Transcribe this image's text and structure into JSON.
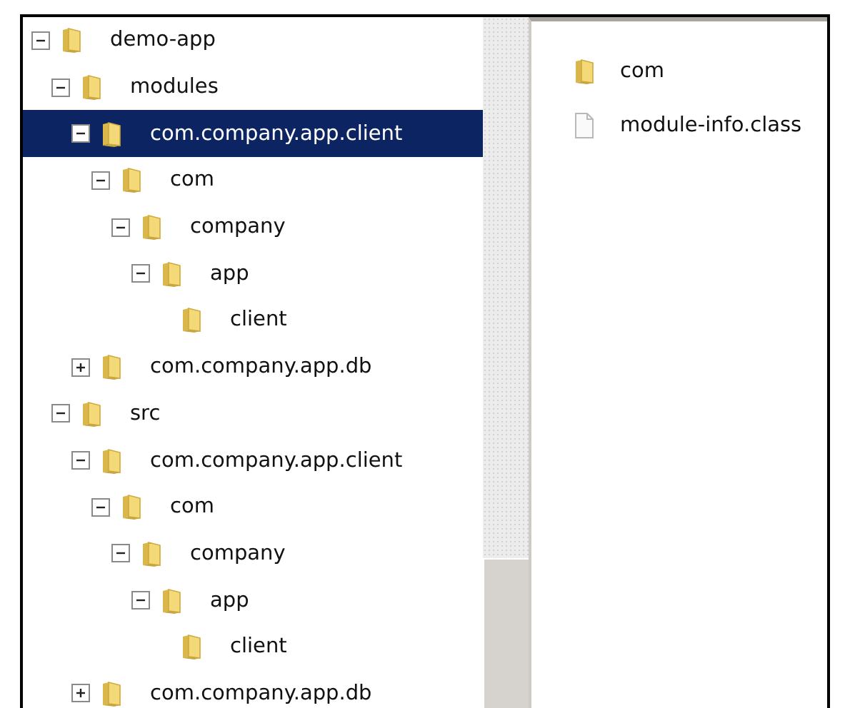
{
  "folder_tree": [
    {
      "label": "demo-app",
      "kind": "folder",
      "expanded": true,
      "selected": false,
      "children": [
        {
          "label": "modules",
          "kind": "folder",
          "expanded": true,
          "selected": false,
          "children": [
            {
              "label": "com.company.app.client",
              "kind": "folder",
              "expanded": true,
              "selected": true,
              "children": [
                {
                  "label": "com",
                  "kind": "folder",
                  "expanded": true,
                  "selected": false,
                  "children": [
                    {
                      "label": "company",
                      "kind": "folder",
                      "expanded": true,
                      "selected": false,
                      "children": [
                        {
                          "label": "app",
                          "kind": "folder",
                          "expanded": true,
                          "selected": false,
                          "children": [
                            {
                              "label": "client",
                              "kind": "folder",
                              "selected": false
                            }
                          ]
                        }
                      ]
                    }
                  ]
                }
              ]
            },
            {
              "label": "com.company.app.db",
              "kind": "folder",
              "expanded": false,
              "selected": false
            }
          ]
        },
        {
          "label": "src",
          "kind": "folder",
          "expanded": true,
          "selected": false,
          "children": [
            {
              "label": "com.company.app.client",
              "kind": "folder",
              "expanded": true,
              "selected": false,
              "children": [
                {
                  "label": "com",
                  "kind": "folder",
                  "expanded": true,
                  "selected": false,
                  "children": [
                    {
                      "label": "company",
                      "kind": "folder",
                      "expanded": true,
                      "selected": false,
                      "children": [
                        {
                          "label": "app",
                          "kind": "folder",
                          "expanded": true,
                          "selected": false,
                          "children": [
                            {
                              "label": "client",
                              "kind": "folder",
                              "selected": false
                            }
                          ]
                        }
                      ]
                    }
                  ]
                }
              ]
            },
            {
              "label": "com.company.app.db",
              "kind": "folder",
              "expanded": false,
              "selected": false
            }
          ]
        }
      ]
    }
  ],
  "file_list": [
    {
      "label": "com",
      "kind": "folder",
      "selected": false
    },
    {
      "label": "module-info.class",
      "kind": "file",
      "selected": false
    }
  ]
}
